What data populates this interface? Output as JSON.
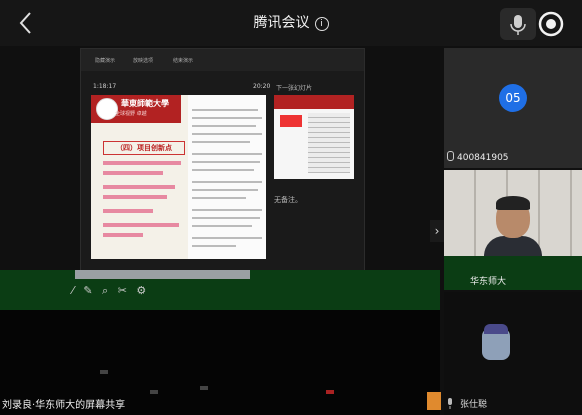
{
  "header": {
    "title": "腾讯会议",
    "info_glyph": "i",
    "back_icon": "chevron-left-icon",
    "mic_icon": "microphone-icon",
    "record_icon": "record-icon"
  },
  "share": {
    "toolbar": [
      "隐藏演示",
      "放映选项",
      "结束演示"
    ],
    "elapsed_time": "1:18:17",
    "clock": "20:20",
    "next_slide_label": "下一张幻灯片",
    "notes_placeholder": "无备注。",
    "slide": {
      "university_name": "華東師範大學",
      "university_sub": "全球视野 卓越",
      "section_title": "（四）项目创新点"
    }
  },
  "participants": [
    {
      "id": "400841905",
      "avatar_text": "05"
    },
    {
      "label": "华东师大"
    },
    {
      "label": "张仕聪"
    }
  ],
  "toolbar_glyphs": "⁄ ✎ ⌕ ✂ ⚙",
  "caption": "刘录良·华东师大的屏幕共享",
  "colors": {
    "accent_blue": "#1f6fe6",
    "slide_red": "#b22222"
  }
}
